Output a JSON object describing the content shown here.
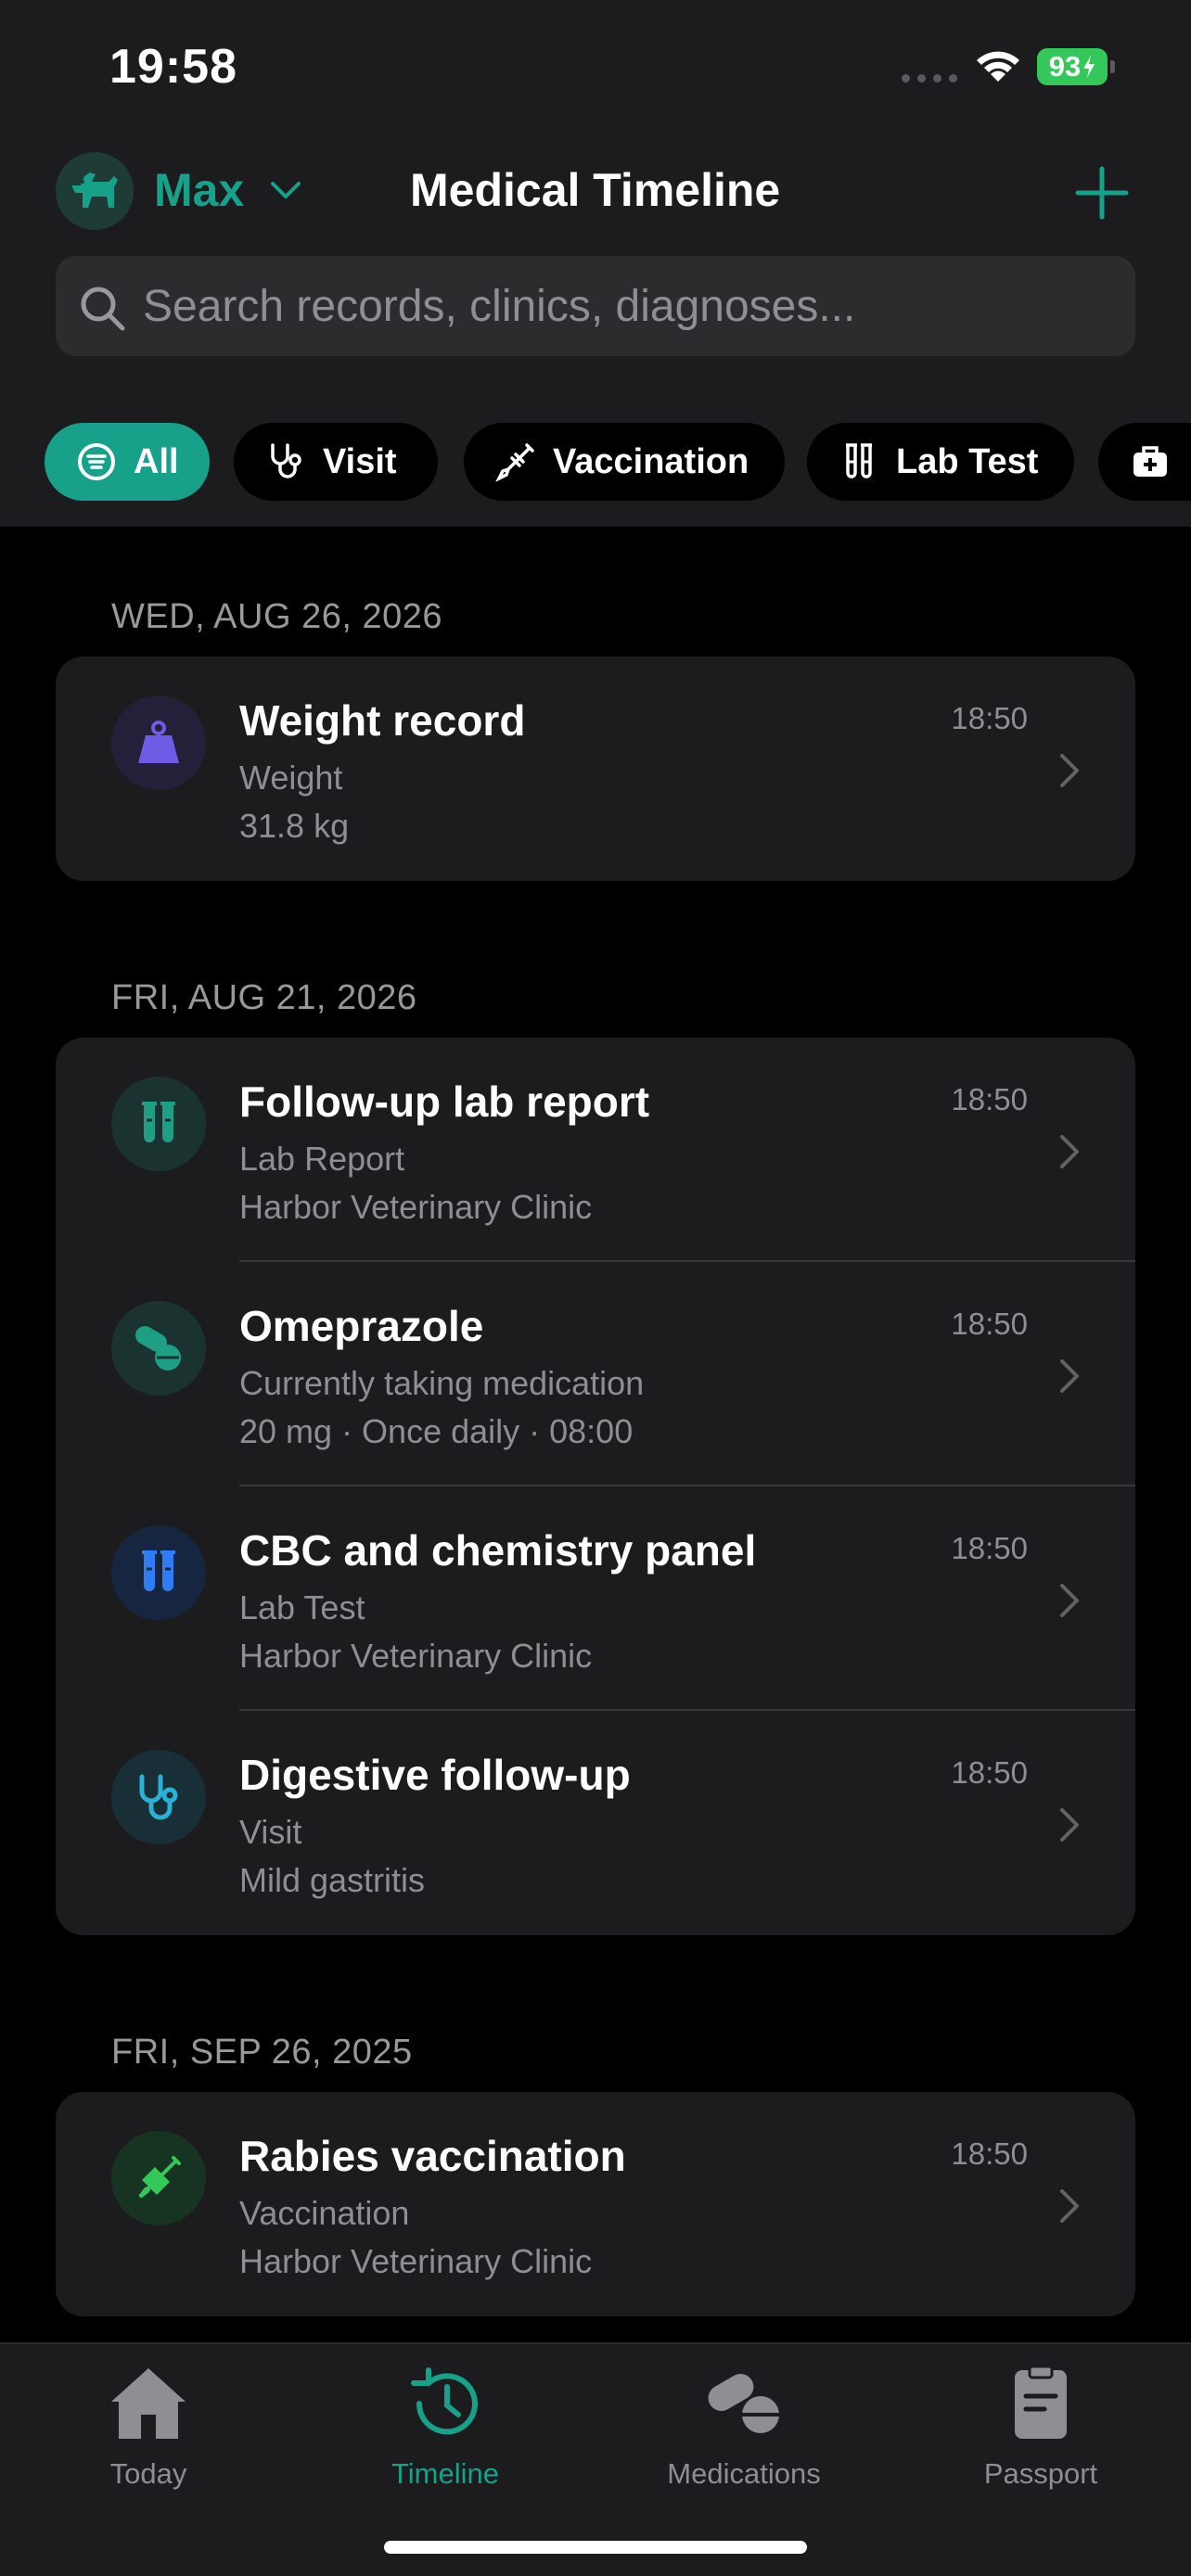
{
  "status_bar": {
    "time": "19:58",
    "battery": "93"
  },
  "header": {
    "pet_name": "Max",
    "title": "Medical Timeline"
  },
  "search": {
    "placeholder": "Search records, clinics, diagnoses..."
  },
  "filters": [
    {
      "label": "All",
      "icon": "filter-list-icon",
      "active": true
    },
    {
      "label": "Visit",
      "icon": "stethoscope-icon"
    },
    {
      "label": "Vaccination",
      "icon": "syringe-icon"
    },
    {
      "label": "Lab Test",
      "icon": "test-tubes-icon"
    },
    {
      "label": "",
      "icon": "medical-kit-icon"
    }
  ],
  "sections": [
    {
      "date": "WED, AUG 26, 2026",
      "records": [
        {
          "title": "Weight record",
          "subtitle": "Weight",
          "detail": "31.8 kg",
          "time": "18:50",
          "icon": "weight-icon",
          "color": "#6e5ce6"
        }
      ]
    },
    {
      "date": "FRI, AUG 21, 2026",
      "records": [
        {
          "title": "Follow-up lab report",
          "subtitle": "Lab Report",
          "detail": "Harbor Veterinary Clinic",
          "time": "18:50",
          "icon": "test-tubes-icon",
          "color": "#1f9e86"
        },
        {
          "title": "Omeprazole",
          "subtitle": "Currently taking medication",
          "detail": "20 mg · Once daily · 08:00",
          "time": "18:50",
          "icon": "pills-icon",
          "color": "#1f9e86"
        },
        {
          "title": "CBC and chemistry panel",
          "subtitle": "Lab Test",
          "detail": "Harbor Veterinary Clinic",
          "time": "18:50",
          "icon": "test-tubes-icon",
          "color": "#2f7df6"
        },
        {
          "title": "Digestive follow-up",
          "subtitle": "Visit",
          "detail": "Mild gastritis",
          "time": "18:50",
          "icon": "stethoscope-icon",
          "color": "#2bb0d6"
        }
      ]
    },
    {
      "date": "FRI, SEP 26, 2025",
      "records": [
        {
          "title": "Rabies vaccination",
          "subtitle": "Vaccination",
          "detail": "Harbor Veterinary Clinic",
          "time": "18:50",
          "icon": "syringe-icon",
          "color": "#34c759"
        }
      ]
    }
  ],
  "tabs": [
    {
      "label": "Today",
      "icon": "house-icon"
    },
    {
      "label": "Timeline",
      "icon": "clock-history-icon",
      "active": true
    },
    {
      "label": "Medications",
      "icon": "pills-icon"
    },
    {
      "label": "Passport",
      "icon": "clipboard-icon"
    }
  ],
  "colors": {
    "accent": "#17a08a",
    "background": "#000000",
    "surface": "#1c1c1e"
  }
}
